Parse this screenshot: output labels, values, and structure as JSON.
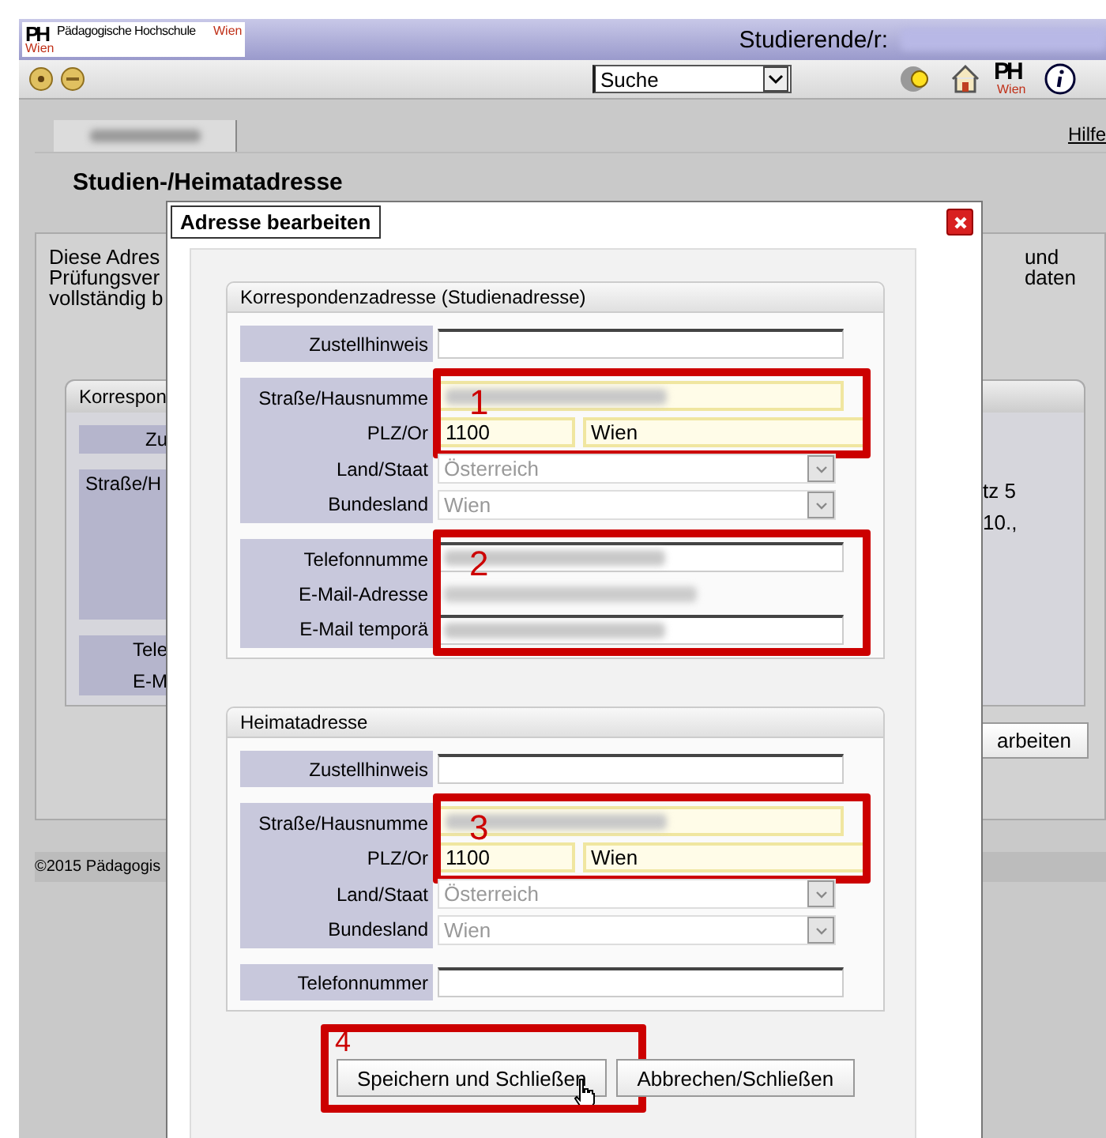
{
  "header": {
    "logo_mark": "PH",
    "logo_text": "Pädagogische Hochschule",
    "logo_city": "Wien",
    "logo_city_below": "Wien",
    "user_label": "Studierende/r:",
    "user_redacted": true
  },
  "toolbar": {
    "search_select": "Suche",
    "ph_mark": "PH",
    "ph_city": "Wien"
  },
  "page": {
    "tab_redacted": true,
    "help_link": "Hilfe",
    "title": "Studien-/Heimatadresse",
    "intro_left": [
      "Diese Adres",
      "Prüfungsver",
      "vollständig b"
    ],
    "intro_right": [
      "und",
      "daten"
    ],
    "card_title": "Korrespon",
    "card_label_short": "Zu",
    "card_label_street": "Straße/H",
    "card_labels_contact": [
      "Tele",
      "E-M"
    ],
    "card_values": [
      "tz 5",
      "10.,"
    ],
    "edit_button": "arbeiten",
    "footer": "©2015 Pädagogis"
  },
  "dialog": {
    "title": "Adresse bearbeiten",
    "sections": [
      {
        "title": "Korrespondenzadresse (Studienadresse)",
        "groups": [
          {
            "blocks": [
              {
                "rows": [
                  {
                    "kind": "input",
                    "label": "Zustellhinweis",
                    "highlighted": false,
                    "redacted": false
                  }
                ]
              }
            ]
          },
          {
            "blocks": [
              {
                "annotation": "1",
                "rows": [
                  {
                    "kind": "input",
                    "label": "Straße/Hausnumme",
                    "highlighted": true,
                    "redacted": true
                  },
                  {
                    "kind": "split",
                    "label": "PLZ/Or",
                    "values": [
                      "1100",
                      "Wien"
                    ],
                    "highlighted": true
                  }
                ]
              },
              {
                "rows": [
                  {
                    "kind": "select",
                    "label": "Land/Staat",
                    "value": "Österreich",
                    "disabled": true
                  },
                  {
                    "kind": "select",
                    "label": "Bundesland",
                    "value": "Wien",
                    "disabled": true
                  }
                ]
              }
            ]
          },
          {
            "blocks": [
              {
                "annotation": "2",
                "rows": [
                  {
                    "kind": "input",
                    "label": "Telefonnumme",
                    "highlighted": false,
                    "redacted": true
                  },
                  {
                    "kind": "static",
                    "label": "E-Mail-Adresse",
                    "redacted": true
                  },
                  {
                    "kind": "input",
                    "label": "E-Mail temporä",
                    "highlighted": false,
                    "redacted": true
                  }
                ]
              }
            ]
          }
        ]
      },
      {
        "title": "Heimatadresse",
        "groups": [
          {
            "blocks": [
              {
                "rows": [
                  {
                    "kind": "input",
                    "label": "Zustellhinweis",
                    "highlighted": false,
                    "redacted": false
                  }
                ]
              }
            ]
          },
          {
            "blocks": [
              {
                "annotation": "3",
                "rows": [
                  {
                    "kind": "input",
                    "label": "Straße/Hausnumme",
                    "highlighted": true,
                    "redacted": true
                  },
                  {
                    "kind": "split",
                    "label": "PLZ/Or",
                    "values": [
                      "1100",
                      "Wien"
                    ],
                    "highlighted": true
                  }
                ]
              },
              {
                "rows": [
                  {
                    "kind": "select",
                    "label": "Land/Staat",
                    "value": "Österreich",
                    "disabled": true
                  },
                  {
                    "kind": "select",
                    "label": "Bundesland",
                    "value": "Wien",
                    "disabled": true
                  }
                ]
              }
            ]
          },
          {
            "blocks": [
              {
                "rows": [
                  {
                    "kind": "input",
                    "label": "Telefonnummer",
                    "highlighted": false,
                    "redacted": false
                  }
                ]
              }
            ]
          }
        ]
      }
    ],
    "buttons": [
      {
        "label": "Speichern und Schließen",
        "annotation": "4",
        "hovered": true
      },
      {
        "label": "Abbrechen/Schließen",
        "hovered": false
      }
    ]
  }
}
